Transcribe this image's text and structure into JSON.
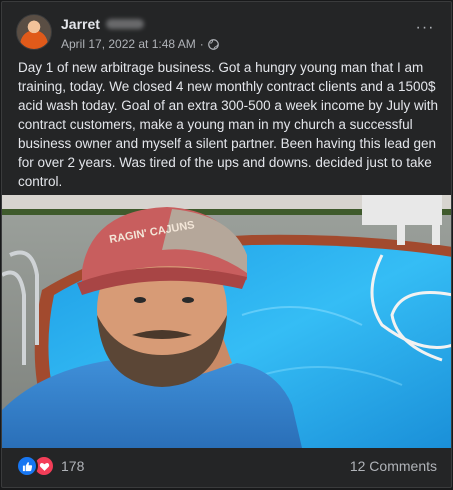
{
  "post": {
    "author_name": "Jarret",
    "timestamp": "April 17, 2022 at 1:48 AM",
    "separator": "·",
    "audience_icon": "globe-icon",
    "more_options_label": "···",
    "text": "Day 1 of new arbitrage business. Got a hungry young man that I am training, today.  We closed 4 new monthly contract clients and a 1500$ acid wash today. Goal of an extra 300-500  a week income by July with contract customers, make a young man in my church a successful business owner and myself a silent partner. Been having this lead gen for over 2 years. Was tired of the ups and downs. decided just to take control.",
    "photo": {
      "cap_text": "RAGIN' CAJUNS"
    }
  },
  "footer": {
    "reaction_icons": [
      "like-icon",
      "love-icon"
    ],
    "reaction_count": "178",
    "comments_label": "12 Comments"
  },
  "colors": {
    "card_bg": "#242526",
    "text_primary": "#e4e6eb",
    "text_secondary": "#b0b3b8",
    "like_blue": "#1877f2",
    "love_red": "#f33e58",
    "pool_water": "#2fb3f0"
  }
}
